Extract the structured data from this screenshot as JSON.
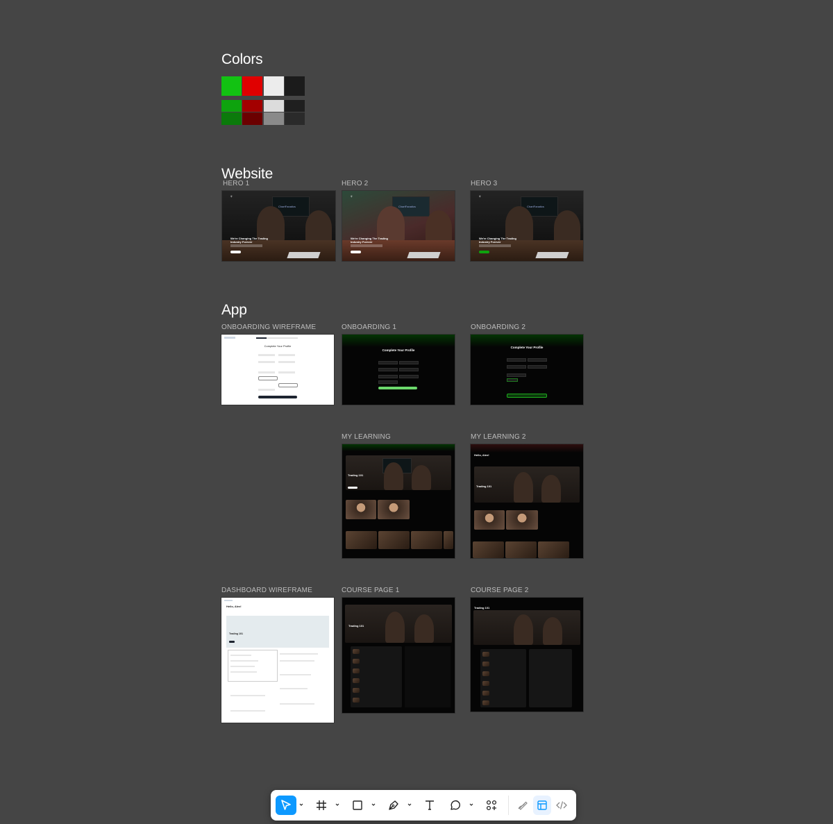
{
  "canvas": {
    "background": "#454545"
  },
  "sections": {
    "colors": {
      "title": "Colors"
    },
    "website": {
      "title": "Website"
    },
    "app": {
      "title": "App"
    }
  },
  "palette": {
    "rows": [
      [
        "#12c212",
        "#e00000",
        "#ececec",
        "#1b1b1b"
      ],
      [
        "#0ea30e",
        "#a30000",
        "#dcdcdc",
        "#1f1f1f"
      ],
      [
        "#0b7a0b",
        "#6b0000",
        "#8a8a8a",
        "#2a2a2a"
      ]
    ]
  },
  "frames": {
    "hero1": {
      "label": "HERO 1",
      "headline": "We're Changing The Trading Industry Forever",
      "brand": "ChartFanatics"
    },
    "hero2": {
      "label": "HERO 2",
      "headline": "We're Changing The Trading Industry Forever",
      "brand": "ChartFanatics"
    },
    "hero3": {
      "label": "HERO 3",
      "headline": "We're Changing The Trading Industry Forever",
      "brand": "ChartFanatics"
    },
    "onboarding_wireframe": {
      "label": "ONBOARDING WIREFRAME",
      "heading": "Complete Your Profile"
    },
    "onboarding1": {
      "label": "ONBOARDING 1",
      "heading": "Complete Your Profile"
    },
    "onboarding2": {
      "label": "ONBOARDING 2",
      "heading": "Complete Your Profile"
    },
    "my_learning": {
      "label": "MY LEARNING",
      "course": "Trading 101",
      "brand": "ChartFanatics"
    },
    "my_learning2": {
      "label": "MY LEARNING 2",
      "greeting": "Hello, Alex!",
      "course": "Trading 101",
      "brand": "ChartFanatics"
    },
    "dashboard_wireframe": {
      "label": "DASHBOARD WIREFRAME",
      "greeting": "Hello, Alex!",
      "course": "Trading 101"
    },
    "course_page1": {
      "label": "COURSE PAGE 1",
      "course": "Trading 101",
      "brand": "ChartFanatics"
    },
    "course_page2": {
      "label": "COURSE PAGE 2",
      "course": "Trading 101",
      "brand": "ChartFanatics"
    }
  },
  "toolbar": {
    "tools": [
      {
        "name": "move-tool",
        "icon": "cursor-arrow-icon",
        "active": true
      },
      {
        "name": "frame-tool",
        "icon": "frame-hash-icon"
      },
      {
        "name": "shape-tool",
        "icon": "rectangle-icon"
      },
      {
        "name": "pen-tool",
        "icon": "pen-nib-icon"
      },
      {
        "name": "text-tool",
        "icon": "text-t-icon"
      },
      {
        "name": "comment-tool",
        "icon": "comment-bubble-icon"
      },
      {
        "name": "actions-tool",
        "icon": "actions-grid-icon"
      },
      {
        "name": "draw-mode",
        "icon": "draw-pencil-icon"
      },
      {
        "name": "design-mode",
        "icon": "design-layout-icon",
        "selected": true
      },
      {
        "name": "dev-mode",
        "icon": "code-brackets-icon"
      }
    ],
    "accent": "#0d99ff"
  }
}
